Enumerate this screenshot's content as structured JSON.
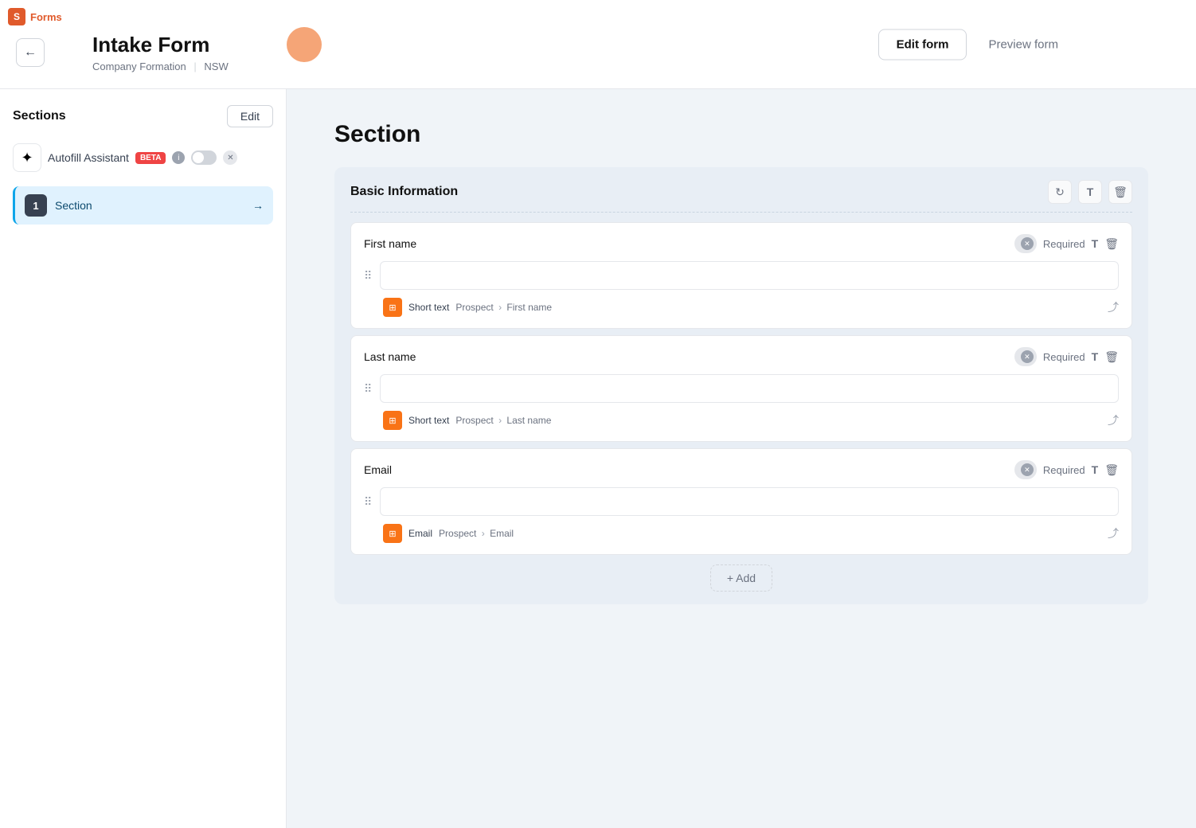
{
  "app": {
    "name": "Forms",
    "logo_char": "S"
  },
  "header": {
    "title": "Intake Form",
    "subtitle_company": "Company Formation",
    "subtitle_region": "NSW",
    "back_label": "←",
    "edit_form_label": "Edit form",
    "preview_form_label": "Preview form"
  },
  "sidebar": {
    "sections_label": "Sections",
    "edit_label": "Edit",
    "autofill": {
      "label": "Autofill Assistant",
      "badge": "BETA"
    },
    "items": [
      {
        "num": "1",
        "name": "Section"
      }
    ]
  },
  "content": {
    "section_title": "Section",
    "subsection_title": "Basic Information",
    "fields": [
      {
        "label": "First name",
        "required_label": "Required",
        "meta_type": "Short text",
        "meta_source": "Prospect",
        "meta_field": "First name"
      },
      {
        "label": "Last name",
        "required_label": "Required",
        "meta_type": "Short text",
        "meta_source": "Prospect",
        "meta_field": "Last name"
      },
      {
        "label": "Email",
        "required_label": "Required",
        "meta_type": "Email",
        "meta_source": "Prospect",
        "meta_field": "Email"
      }
    ],
    "add_label": "+ Add"
  }
}
